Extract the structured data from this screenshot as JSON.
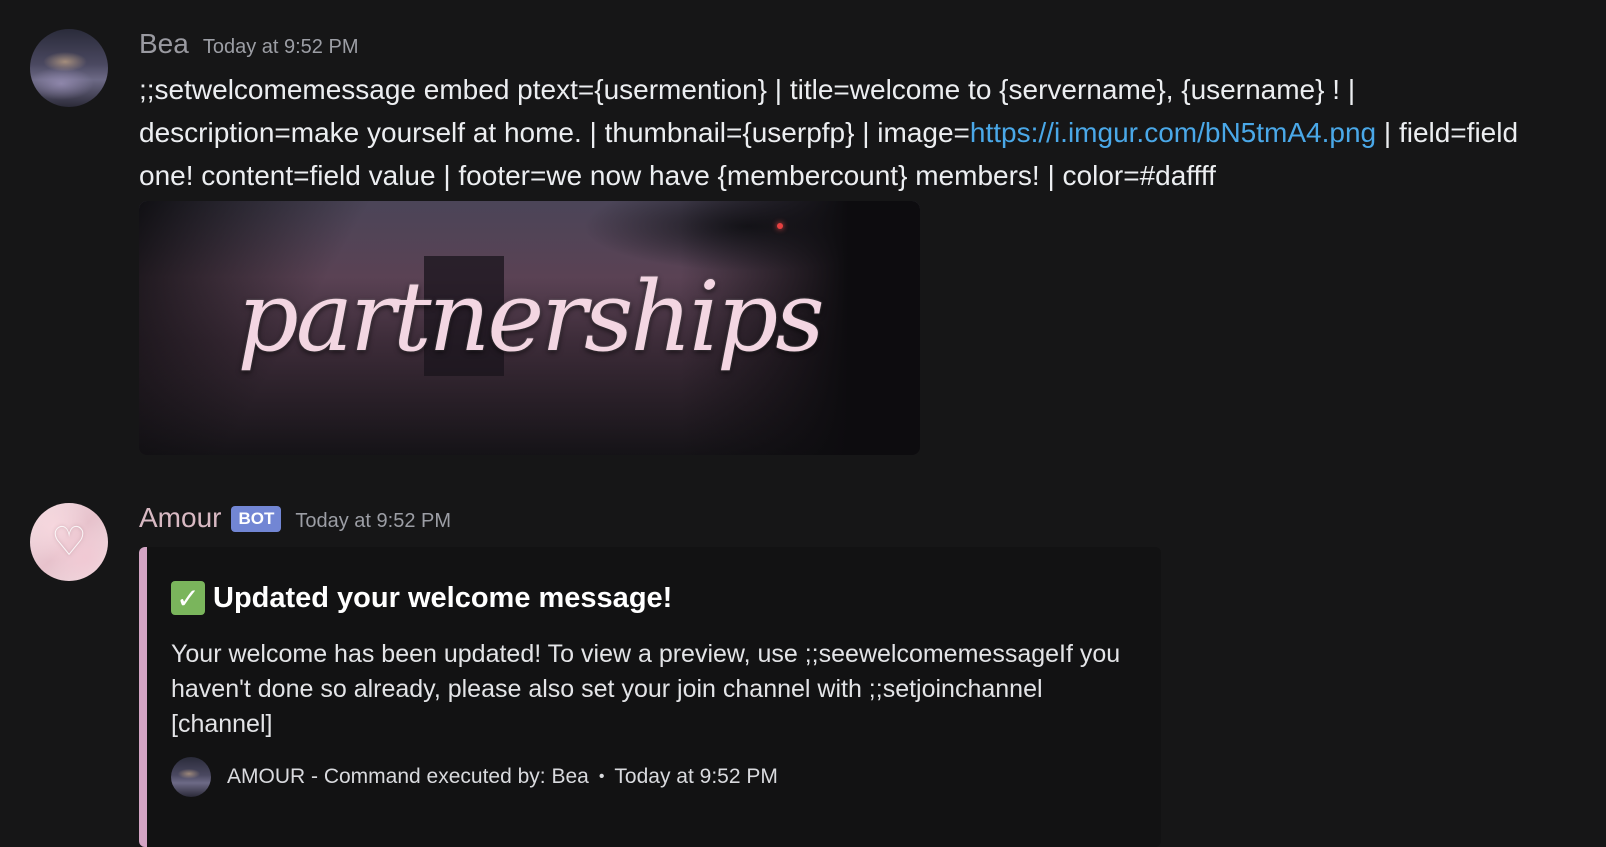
{
  "messages": [
    {
      "author": "Bea",
      "timestamp": "Today at 9:52 PM",
      "content_text": ";;setwelcomemessage embed ptext={usermention} | title=welcome to {servername}, {username} ! | description=make yourself at home.  | thumbnail={userpfp} | image=",
      "content_link": "https://i.imgur.com/bN5tmA4.png",
      "content_text_after": " | field=field one! content=field value | footer=we now have {membercount} members! | color=#daffff",
      "attachment_text": "partnerships"
    },
    {
      "author": "Amour",
      "badge": "BOT",
      "timestamp": "Today at 9:52 PM",
      "embed": {
        "accent_color": "#d3a4c4",
        "icon": "check-mark-icon",
        "title": "Updated your welcome message!",
        "description": "Your welcome has been updated! To view a preview, use ;;seewelcomemessageIf you haven't done so already, please also set your join channel with ;;setjoinchannel [channel]",
        "footer_text": "AMOUR - Command executed by: Bea",
        "footer_separator": "•",
        "footer_timestamp": "Today at 9:52 PM"
      }
    }
  ]
}
